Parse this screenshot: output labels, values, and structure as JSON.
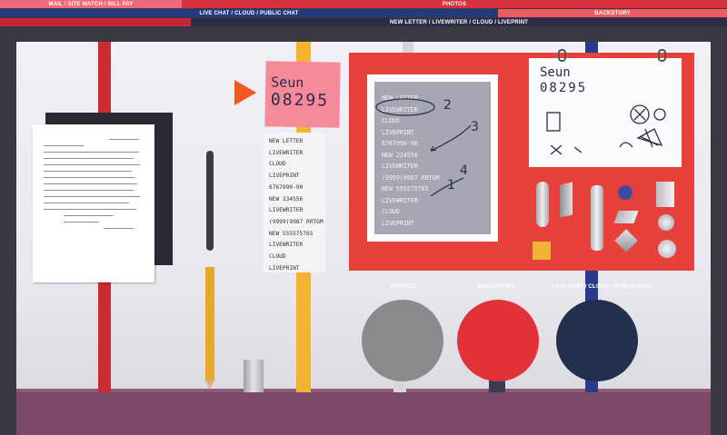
{
  "nav": {
    "mail": "MAIL / SITE WATCH / BILL PAY",
    "photos": "PHOTOS",
    "live": "LIVE CHAT / CLOUD / PUBLIC CHAT",
    "backstory": "BACKSTORY",
    "newletter": "NEW LETTER / LIVEWRITER / CLOUD / LIVEPRINT"
  },
  "sticky": {
    "line1": "Seun",
    "line2": "08295"
  },
  "list_items": [
    "NEW LETTER",
    "LIVEWRITER",
    "CLOUD",
    "LIVEPRINT",
    "6767990-90",
    "NEW 234556",
    "LIVEWRITER",
    "(9999)9987 RRTGM",
    "NEW 555575765",
    "LIVEWRITER",
    "CLOUD",
    "LIVEPRINT"
  ],
  "frame_items": [
    "NEW LETTER",
    "LIVEWRITER",
    "CLOUD",
    "LIVEPRINT",
    "6767990-90",
    "NEW 234556",
    "LIVEWRITER",
    "(9999)9987 RRTGM",
    "NEW 555575765",
    "LIVEWRITER",
    "CLOUD",
    "LIVEPRINT"
  ],
  "annotations": {
    "n1": "1",
    "n2": "2",
    "n3": "3",
    "n4": "4"
  },
  "paper2": {
    "line1": "Seun",
    "line2": "08295"
  },
  "buttons": {
    "photos": "PHOTOS",
    "backstory": "BACKSTORY",
    "live": "LIVE CHAT / CLOUD / PUBLIC CHAT"
  },
  "colors": {
    "photos_circle": "#8a8a8d",
    "backstory_circle": "#e23138",
    "live_circle": "#23304d"
  }
}
